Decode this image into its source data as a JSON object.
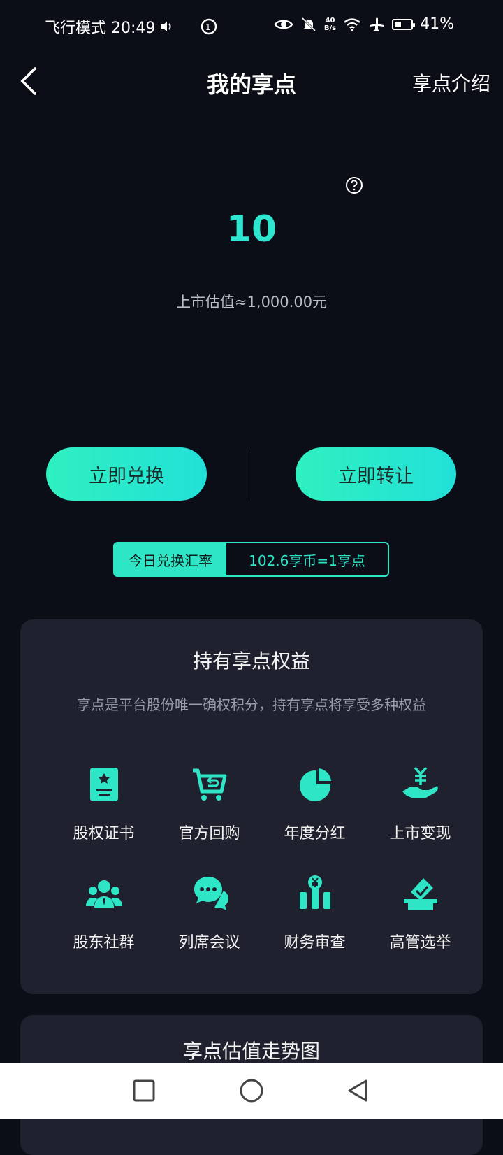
{
  "status_bar": {
    "left_text": "飞行模式 20:49",
    "network_speed_top": "40",
    "network_speed_bottom": "B/s",
    "battery_percent": "41%",
    "battery_level": 0.41
  },
  "nav": {
    "title": "我的享点",
    "right_link": "享点介绍"
  },
  "hero": {
    "points": "10",
    "valuation": "上市估值≈1,000.00元"
  },
  "actions": {
    "exchange_label": "立即兑换",
    "transfer_label": "立即转让"
  },
  "rate": {
    "label": "今日兑换汇率",
    "value": "102.6享币=1享点"
  },
  "benefits": {
    "title": "持有享点权益",
    "subtitle": "享点是平台股份唯一确权积分，持有享点将享受多种权益",
    "items": [
      {
        "label": "股权证书",
        "icon": "certificate-icon"
      },
      {
        "label": "官方回购",
        "icon": "cart-return-icon"
      },
      {
        "label": "年度分红",
        "icon": "pie-chart-icon"
      },
      {
        "label": "上市变现",
        "icon": "yen-hand-icon"
      },
      {
        "label": "股东社群",
        "icon": "group-icon"
      },
      {
        "label": "列席会议",
        "icon": "chat-bubbles-icon"
      },
      {
        "label": "财务审查",
        "icon": "finance-chart-icon"
      },
      {
        "label": "高管选举",
        "icon": "ballot-box-icon"
      }
    ]
  },
  "trend": {
    "title": "享点估值走势图"
  },
  "colors": {
    "accent": "#2ee6c6",
    "background": "#0b0e17",
    "card": "#1f222e"
  }
}
